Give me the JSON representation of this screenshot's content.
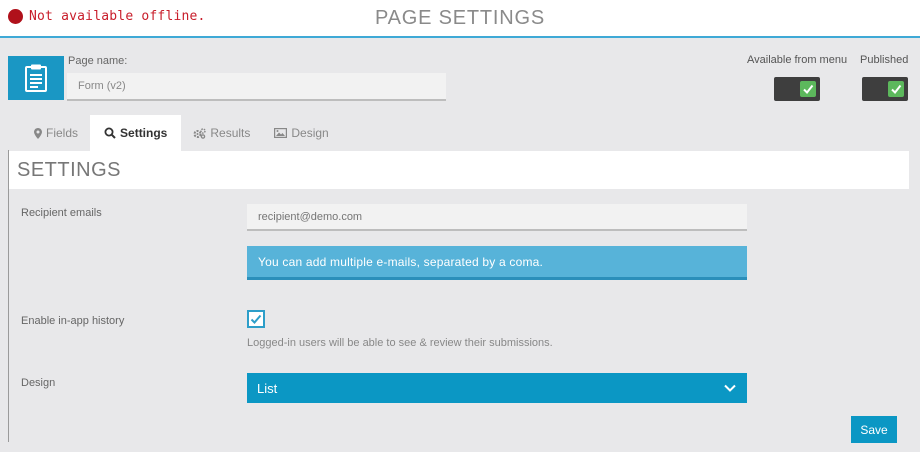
{
  "header": {
    "status_text": "Not available offline.",
    "title": "PAGE SETTINGS",
    "status_color": "#b0111b",
    "accent_color": "#3fa9d6"
  },
  "page": {
    "icon": "clipboard-icon",
    "name_label": "Page name:",
    "name_value": "Form (v2)"
  },
  "toggles": {
    "menu_label": "Available from menu",
    "menu_on": true,
    "published_label": "Published",
    "published_on": true
  },
  "tabs": [
    {
      "label": "Fields",
      "icon": "map-marker-icon",
      "active": false
    },
    {
      "label": "Settings",
      "icon": "search-icon",
      "active": true
    },
    {
      "label": "Results",
      "icon": "gears-icon",
      "active": false
    },
    {
      "label": "Design",
      "icon": "image-icon",
      "active": false
    }
  ],
  "settings": {
    "heading": "SETTINGS",
    "recipient_label": "Recipient emails",
    "recipient_placeholder": "recipient@demo.com",
    "recipient_hint": "You can add multiple e-mails, separated by a coma.",
    "history_label": "Enable in-app history",
    "history_checked": true,
    "history_help": "Logged-in users will be able to see & review their submissions.",
    "design_label": "Design",
    "design_value": "List",
    "save_label": "Save"
  }
}
